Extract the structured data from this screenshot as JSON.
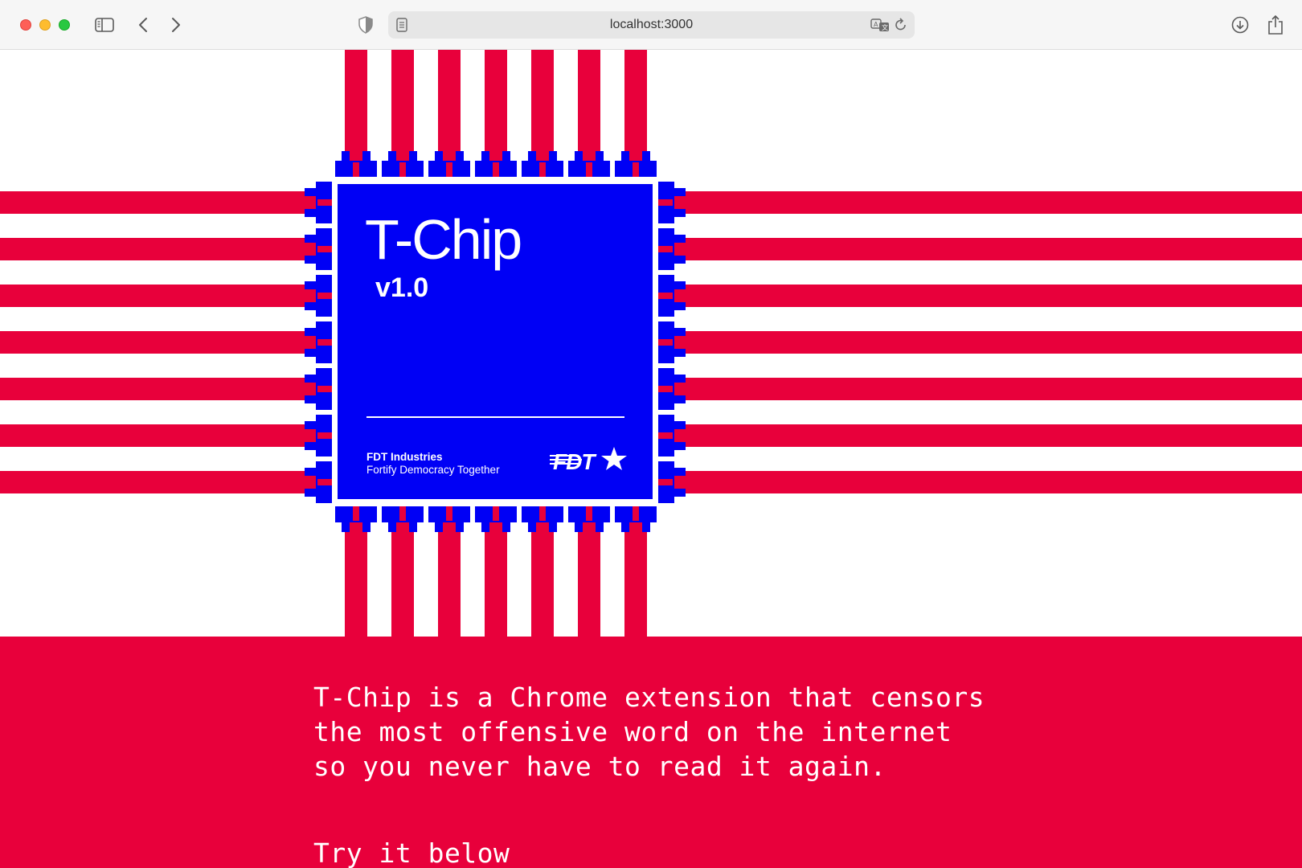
{
  "browser": {
    "url": "localhost:3000",
    "icons": [
      "sidebar-icon",
      "back-icon",
      "forward-icon",
      "shield-icon",
      "page-icon",
      "translate-icon",
      "reload-icon",
      "download-icon",
      "share-icon"
    ]
  },
  "chip": {
    "title": "T-Chip",
    "version": "v1.0",
    "company": "FDT Industries",
    "tagline": "Fortify Democracy Together",
    "logo_text": "FDT"
  },
  "content": {
    "description_lines": [
      "T-Chip is a Chrome extension that censors",
      "the most offensive word on the internet",
      "so you never have to read it again."
    ],
    "cta": "Try it below"
  },
  "colors": {
    "red": "#e8003b",
    "blue": "#0000f5",
    "white": "#ffffff"
  }
}
